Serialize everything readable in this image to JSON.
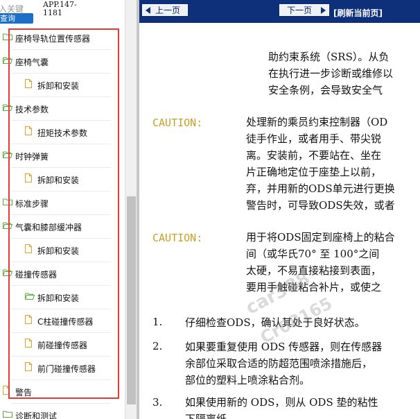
{
  "left_pane": {
    "search_hint": "入关键",
    "query_button": "查询",
    "app_code_line1": "APP.147-",
    "app_code_line2": "1181",
    "tree": [
      {
        "label": "座椅导轨位置传感器",
        "level": 0,
        "icon": "folder-closed-icon"
      },
      {
        "label": "座椅气囊",
        "level": 0,
        "icon": "folder-open-icon"
      },
      {
        "label": "拆卸和安装",
        "level": 1,
        "icon": "document-icon"
      },
      {
        "label": "技术参数",
        "level": 0,
        "icon": "folder-open-icon"
      },
      {
        "label": "扭矩技术参数",
        "level": 1,
        "icon": "document-icon"
      },
      {
        "label": "时钟弹簧",
        "level": 0,
        "icon": "folder-open-icon"
      },
      {
        "label": "拆卸和安装",
        "level": 1,
        "icon": "document-icon"
      },
      {
        "label": "标准步骤",
        "level": 0,
        "icon": "folder-closed-icon"
      },
      {
        "label": "气囊和膝部缓冲器",
        "level": 0,
        "icon": "folder-open-icon"
      },
      {
        "label": "拆卸和安装",
        "level": 1,
        "icon": "document-icon"
      },
      {
        "label": "碰撞传感器",
        "level": 0,
        "icon": "folder-open-icon"
      },
      {
        "label": "拆卸和安装",
        "level": 1,
        "icon": "folder-open-icon"
      },
      {
        "label": "C柱碰撞传感器",
        "level": 1,
        "icon": "document-icon"
      },
      {
        "label": "前碰撞传感器",
        "level": 1,
        "icon": "document-icon"
      },
      {
        "label": "前门碰撞传感器",
        "level": 1,
        "icon": "document-icon"
      },
      {
        "label": "警告",
        "level": 0,
        "icon": "document-icon"
      },
      {
        "label": "诊断和测试",
        "level": 0,
        "icon": "folder-closed-icon"
      }
    ]
  },
  "nav": {
    "prev": "上一页",
    "next": "下一页",
    "refresh": "[刷新当前页]"
  },
  "content": {
    "intro": [
      "助约束系统（SRS）。从负",
      "在执行进一步诊断或维修以",
      "安全条例，会导致安全气"
    ],
    "caution_label": "CAUTION:",
    "caution1": [
      "处理新的乘员约束控制器（OD",
      "徒手作业，或者用手、带尖锐",
      "离。安装前，不要站在、坐在",
      "片正确地定位于座垫上以前，",
      "弃，并用新的ODS单元进行更换",
      "警告时，可导致ODS失效，或者"
    ],
    "caution2": [
      "用于将ODS固定到座椅上的粘合",
      "间（或华氏70°  至 100°之间",
      "太硬，不易直接粘接到表面，",
      "要用手触碰粘合补片，或使之"
    ],
    "steps": [
      {
        "num": "1.",
        "lines": [
          "仔细检查ODS，确认其处于良好状态。"
        ]
      },
      {
        "num": "2.",
        "lines": [
          "如果要重复使用 ODS 传感器，则在传感器",
          "余部位采取合适的防超范围喷涂措施后，",
          "部位的塑料上喷涂粘合剂。"
        ]
      },
      {
        "num": "3.",
        "lines": [
          "如果使用新的 ODS，则从 ODS 垫的粘性",
          "下隔离纸。"
        ]
      }
    ],
    "watermark1": "car388",
    "watermark2": "Cr08165"
  },
  "colors": {
    "nav_bg": "#0e2f7a",
    "highlight_border": "#e53935",
    "caution": "#c8a025",
    "query_button": "#1b6fc9",
    "folder": "#59a83a"
  }
}
